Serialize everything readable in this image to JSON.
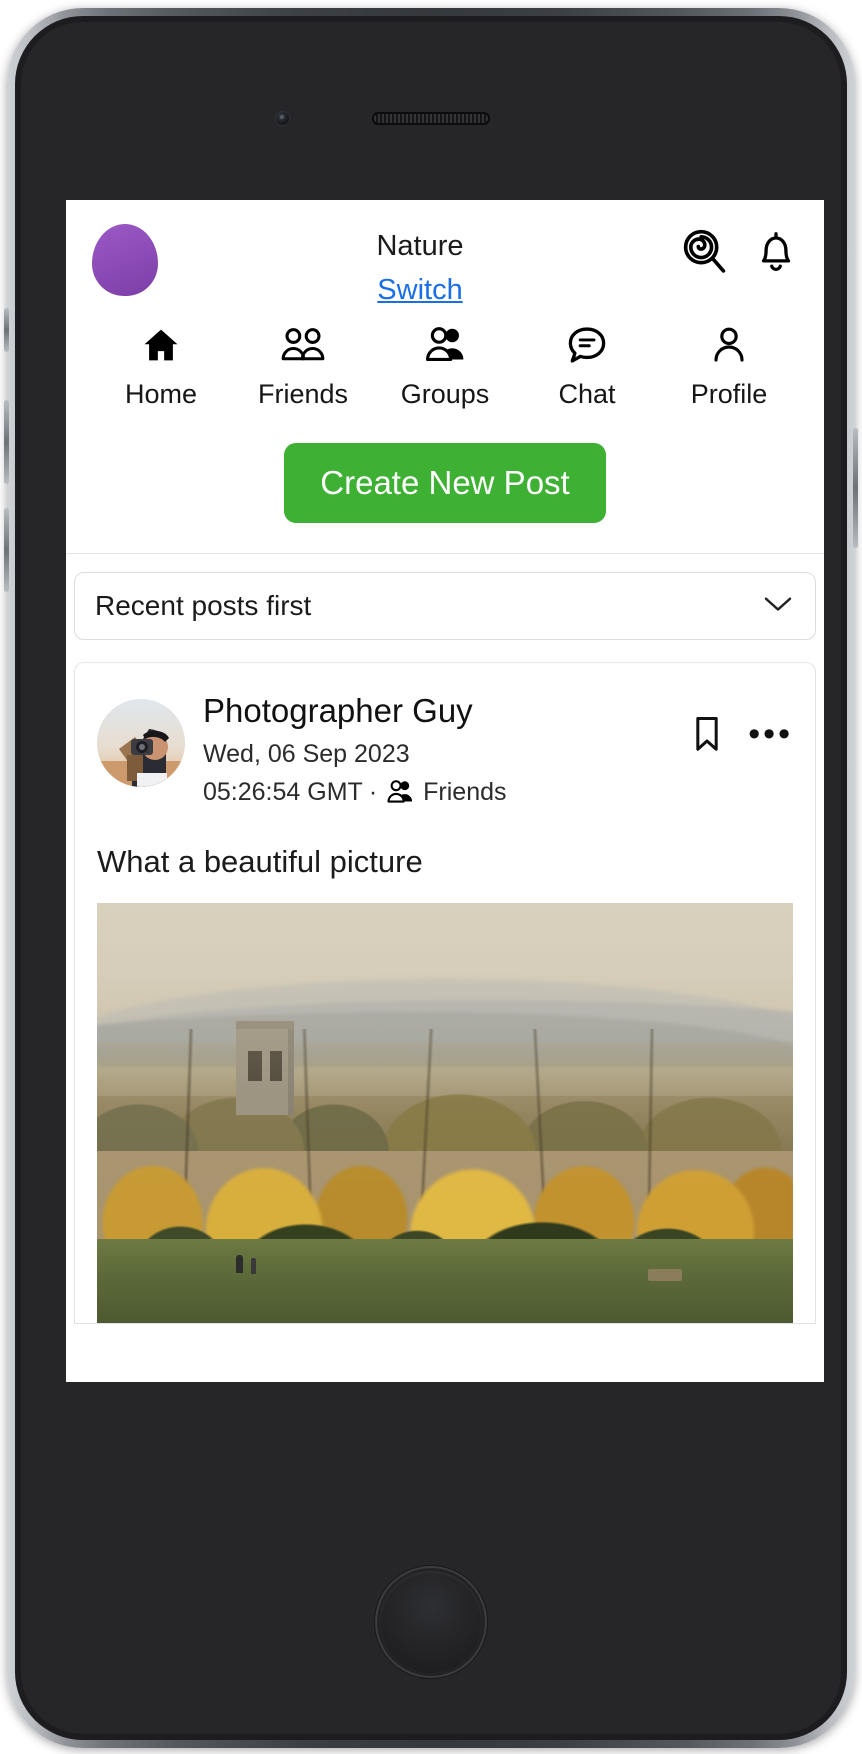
{
  "app": {
    "community_name": "Nature",
    "switch_label": "Switch",
    "avatar_name": "user-avatar"
  },
  "topbar": {
    "search_icon": "search-spiral-icon",
    "notifications_icon": "bell-icon"
  },
  "nav": {
    "items": [
      {
        "label": "Home",
        "icon": "home-icon"
      },
      {
        "label": "Friends",
        "icon": "friends-icon"
      },
      {
        "label": "Groups",
        "icon": "groups-icon"
      },
      {
        "label": "Chat",
        "icon": "chat-bubble-icon"
      },
      {
        "label": "Profile",
        "icon": "person-icon"
      }
    ]
  },
  "actions": {
    "create_post_label": "Create New Post",
    "create_post_color": "#3eb033"
  },
  "sort": {
    "selected": "Recent posts first",
    "chevron_icon": "chevron-down-icon"
  },
  "post": {
    "author": "Photographer Guy",
    "date": "Wed, 06 Sep 2023",
    "time": "05:26:54 GMT",
    "separator": "·",
    "audience": "Friends",
    "audience_icon": "groups-icon",
    "title": "What a beautiful picture",
    "bookmark_icon": "bookmark-icon",
    "more_icon": "more-options-icon",
    "more_glyph": "•••",
    "photo_alt": "autumn-landscape-with-church-tower"
  },
  "colors": {
    "link_blue": "#1a6fe8",
    "accent_green": "#3eb033",
    "avatar_purple": "#8e4db9",
    "text_primary": "#1b1b1b"
  }
}
